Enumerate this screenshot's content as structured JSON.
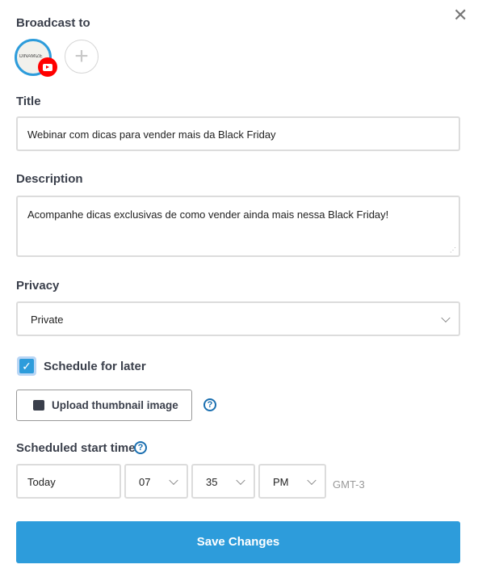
{
  "broadcast_to": {
    "label": "Broadcast to",
    "channel_name": "DINAMIZE",
    "platform": "youtube"
  },
  "title": {
    "label": "Title",
    "value": "Webinar com dicas para vender mais da Black Friday"
  },
  "description": {
    "label": "Description",
    "value": "Acompanhe dicas exclusivas de como vender ainda mais nessa Black Friday!"
  },
  "privacy": {
    "label": "Privacy",
    "value": "Private"
  },
  "schedule": {
    "label": "Schedule for later",
    "checked": true
  },
  "upload": {
    "label": "Upload thumbnail image"
  },
  "start_time": {
    "label": "Scheduled start time",
    "date": "Today",
    "hour": "07",
    "minute": "35",
    "ampm": "PM",
    "timezone": "GMT-3"
  },
  "save": {
    "label": "Save Changes"
  },
  "colors": {
    "accent": "#2d9cdb",
    "youtube": "#ff0000",
    "help": "#1a6fb0"
  }
}
